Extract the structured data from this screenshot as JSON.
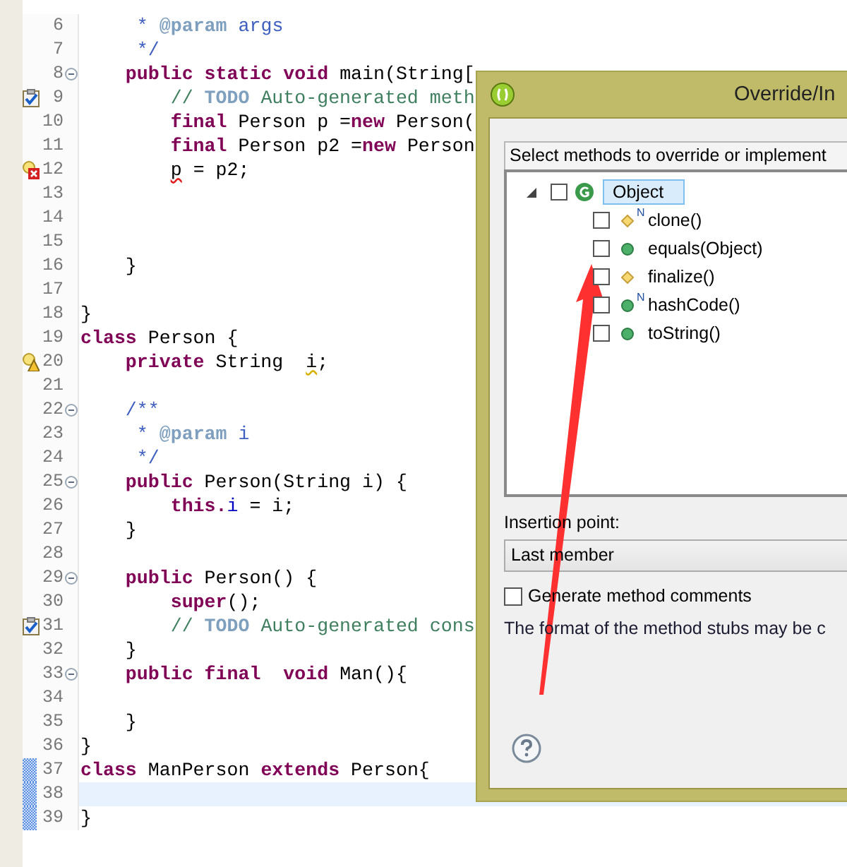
{
  "editor": {
    "lines": [
      {
        "number": "6",
        "tokens": [
          {
            "text": "     *",
            "kind": "javadoc"
          },
          {
            "text": " @param",
            "kind": "doctag"
          },
          {
            "text": " args",
            "kind": "javadoc"
          }
        ]
      },
      {
        "number": "7",
        "tokens": [
          {
            "text": "     */",
            "kind": "javadoc"
          }
        ]
      },
      {
        "number": "8",
        "fold": true,
        "tokens": [
          {
            "text": "    public",
            "kind": "keyword"
          },
          {
            "text": " static",
            "kind": "keyword"
          },
          {
            "text": " void",
            "kind": "keyword"
          },
          {
            "text": " main(String[",
            "kind": "plain"
          }
        ]
      },
      {
        "number": "9",
        "marker": {
          "kind": "task"
        },
        "tokens": [
          {
            "text": "        //",
            "kind": "comment"
          },
          {
            "text": " TODO",
            "kind": "todo"
          },
          {
            "text": " Auto-generated meth",
            "kind": "comment"
          }
        ]
      },
      {
        "number": "10",
        "tokens": [
          {
            "text": "        final",
            "kind": "keyword"
          },
          {
            "text": " Person p =",
            "kind": "plain"
          },
          {
            "text": "new",
            "kind": "keyword"
          },
          {
            "text": " Person(",
            "kind": "plain"
          }
        ]
      },
      {
        "number": "11",
        "tokens": [
          {
            "text": "        final",
            "kind": "keyword"
          },
          {
            "text": " Person p2 =",
            "kind": "plain"
          },
          {
            "text": "new",
            "kind": "keyword"
          },
          {
            "text": " Person",
            "kind": "plain"
          }
        ]
      },
      {
        "number": "12",
        "marker": {
          "kind": "error"
        },
        "tokens": [
          {
            "text": "        p",
            "kind": "error"
          },
          {
            "text": " = p2;",
            "kind": "plain"
          }
        ]
      },
      {
        "number": "13"
      },
      {
        "number": "14"
      },
      {
        "number": "15"
      },
      {
        "number": "16",
        "tokens": [
          {
            "text": "    }",
            "kind": "plain"
          }
        ]
      },
      {
        "number": "17"
      },
      {
        "number": "18",
        "tokens": [
          {
            "text": "}",
            "kind": "plain"
          }
        ]
      },
      {
        "number": "19",
        "tokens": [
          {
            "text": "class",
            "kind": "keyword"
          },
          {
            "text": " Person {",
            "kind": "plain"
          }
        ]
      },
      {
        "number": "20",
        "marker": {
          "kind": "warning"
        },
        "tokens": [
          {
            "text": "    private",
            "kind": "keyword"
          },
          {
            "text": " String  ",
            "kind": "plain"
          },
          {
            "text": "i",
            "kind": "warning"
          },
          {
            "text": ";",
            "kind": "plain"
          }
        ]
      },
      {
        "number": "21"
      },
      {
        "number": "22",
        "fold": true,
        "tokens": [
          {
            "text": "    /**",
            "kind": "javadoc"
          }
        ]
      },
      {
        "number": "23",
        "tokens": [
          {
            "text": "     *",
            "kind": "javadoc"
          },
          {
            "text": " @param",
            "kind": "doctag"
          },
          {
            "text": " i",
            "kind": "javadoc"
          }
        ]
      },
      {
        "number": "24",
        "tokens": [
          {
            "text": "     */",
            "kind": "javadoc"
          }
        ]
      },
      {
        "number": "25",
        "fold": true,
        "tokens": [
          {
            "text": "    public",
            "kind": "keyword"
          },
          {
            "text": " Person(String i) {",
            "kind": "plain"
          }
        ]
      },
      {
        "number": "26",
        "tokens": [
          {
            "text": "        this.",
            "kind": "keyword"
          },
          {
            "text": "i",
            "kind": "field"
          },
          {
            "text": " = i;",
            "kind": "plain"
          }
        ]
      },
      {
        "number": "27",
        "tokens": [
          {
            "text": "    }",
            "kind": "plain"
          }
        ]
      },
      {
        "number": "28"
      },
      {
        "number": "29",
        "fold": true,
        "tokens": [
          {
            "text": "    public",
            "kind": "keyword"
          },
          {
            "text": " Person() {",
            "kind": "plain"
          }
        ]
      },
      {
        "number": "30",
        "tokens": [
          {
            "text": "        super",
            "kind": "keyword"
          },
          {
            "text": "();",
            "kind": "plain"
          }
        ]
      },
      {
        "number": "31",
        "marker": {
          "kind": "task"
        },
        "tokens": [
          {
            "text": "        //",
            "kind": "comment"
          },
          {
            "text": " TODO",
            "kind": "todo"
          },
          {
            "text": " Auto-generated cons",
            "kind": "comment"
          }
        ]
      },
      {
        "number": "32",
        "tokens": [
          {
            "text": "    }",
            "kind": "plain"
          }
        ]
      },
      {
        "number": "33",
        "fold": true,
        "tokens": [
          {
            "text": "    public",
            "kind": "keyword"
          },
          {
            "text": " final",
            "kind": "keyword"
          },
          {
            "text": "  void",
            "kind": "keyword"
          },
          {
            "text": " Man(){",
            "kind": "plain"
          }
        ]
      },
      {
        "number": "34"
      },
      {
        "number": "35",
        "tokens": [
          {
            "text": "    }",
            "kind": "plain"
          }
        ]
      },
      {
        "number": "36",
        "tokens": [
          {
            "text": "}",
            "kind": "plain"
          }
        ]
      },
      {
        "number": "37",
        "changed": true,
        "tokens": [
          {
            "text": "class",
            "kind": "keyword"
          },
          {
            "text": " ManPerson",
            "kind": "plain"
          },
          {
            "text": " extends",
            "kind": "keyword"
          },
          {
            "text": " Person{",
            "kind": "plain"
          }
        ]
      },
      {
        "number": "38",
        "changed": true,
        "current": true
      },
      {
        "number": "39",
        "changed": true,
        "tokens": [
          {
            "text": "}",
            "kind": "plain"
          }
        ]
      }
    ]
  },
  "dialog": {
    "title": "Override/In",
    "prompt": "Select methods to override or implement",
    "tree": {
      "label": "Object",
      "expanded": true,
      "checked": false,
      "selected": true,
      "children": [
        {
          "label": "clone()",
          "kind": "protected",
          "decorator": "N",
          "checked": false
        },
        {
          "label": "equals(Object)",
          "kind": "public",
          "checked": false
        },
        {
          "label": "finalize()",
          "kind": "protected",
          "checked": false
        },
        {
          "label": "hashCode()",
          "kind": "public",
          "decorator": "N",
          "checked": false
        },
        {
          "label": "toString()",
          "kind": "public",
          "checked": false
        }
      ]
    },
    "insertion_label": "Insertion point:",
    "insertion_value": "Last member",
    "comments": {
      "label": "Generate method comments",
      "checked": false
    },
    "note": "The format of the method stubs may be c"
  }
}
